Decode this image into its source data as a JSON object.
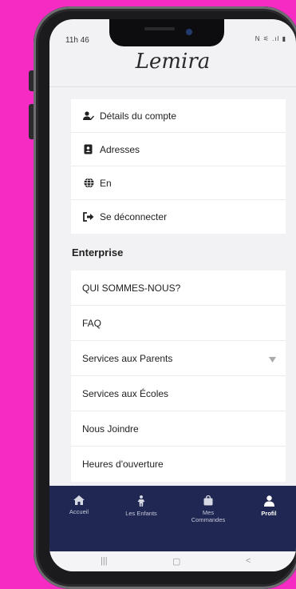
{
  "status": {
    "time": "11h 46",
    "icons": "N ⚟ .ıl ▮"
  },
  "app": {
    "logo": "Lemira"
  },
  "account_menu": [
    {
      "label": "Détails du compte",
      "icon": "user-edit-icon"
    },
    {
      "label": "Adresses",
      "icon": "address-book-icon"
    },
    {
      "label": "En",
      "icon": "globe-icon"
    },
    {
      "label": "Se déconnecter",
      "icon": "logout-icon"
    }
  ],
  "enterprise": {
    "title": "Enterprise",
    "items": [
      {
        "label": "QUI SOMMES-NOUS?"
      },
      {
        "label": "FAQ"
      },
      {
        "label": "Services aux Parents",
        "chevron": "▼"
      },
      {
        "label": "Services aux Écoles"
      },
      {
        "label": "Nous Joindre"
      },
      {
        "label": "Heures d'ouverture"
      }
    ]
  },
  "bottom_nav": [
    {
      "label": "Accueil",
      "icon": "home-icon"
    },
    {
      "label": "Les Enfants",
      "icon": "child-icon"
    },
    {
      "label": "Mes\nCommandes",
      "icon": "bag-icon"
    },
    {
      "label": "Profil",
      "icon": "person-icon",
      "active": true
    }
  ],
  "system_nav": {
    "recents": "|||",
    "home": "▢",
    "back": "<"
  },
  "colors": {
    "background": "#f52bc4",
    "nav_bar": "#1f2752",
    "screen_bg": "#f2f2f4"
  }
}
